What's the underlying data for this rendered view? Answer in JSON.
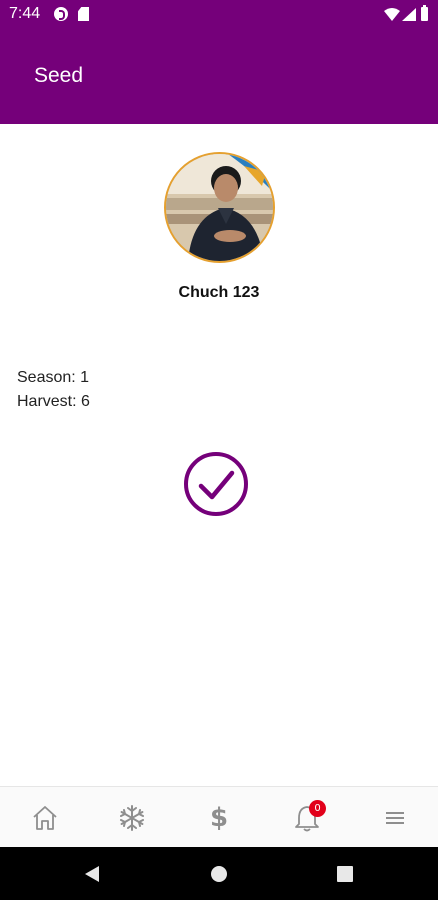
{
  "status_bar": {
    "time": "7:44",
    "icons": [
      "data-saver-icon",
      "sd-card-icon",
      "wifi-icon",
      "signal-icon",
      "battery-icon"
    ]
  },
  "app_bar": {
    "title": "Seed",
    "background_color": "#75007a"
  },
  "profile": {
    "name": "Chuch 123",
    "avatar_border_color": "#e5a02f"
  },
  "info": {
    "season_text": "Season: 1",
    "harvest_text": "Harvest: 6"
  },
  "action": {
    "icon": "check-circle-icon",
    "color": "#75007a"
  },
  "bottom_nav": {
    "items": [
      {
        "icon": "home-icon"
      },
      {
        "icon": "snowflake-icon"
      },
      {
        "icon": "dollar-icon",
        "glyph": "$"
      },
      {
        "icon": "bell-icon",
        "badge": "0"
      },
      {
        "icon": "menu-icon"
      }
    ],
    "icon_color": "#8e8e8e",
    "badge_color": "#e2001a"
  },
  "system_nav": {
    "buttons": [
      "back-icon",
      "home-circle-icon",
      "recents-icon"
    ]
  }
}
